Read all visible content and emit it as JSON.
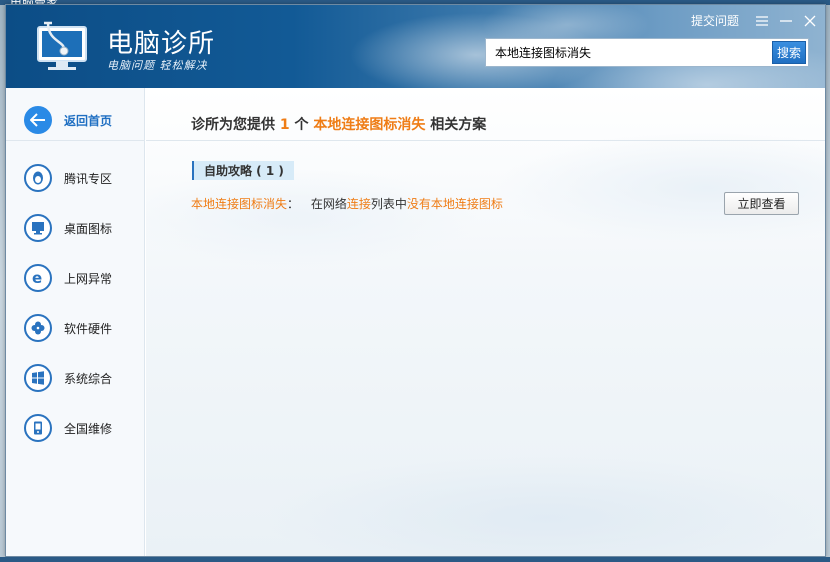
{
  "bg_title": "电脑管家",
  "header": {
    "brand_name": "电脑诊所",
    "slogan": "电脑问题  轻松解决",
    "feedback_label": "提交问题"
  },
  "search": {
    "value": "本地连接图标消失",
    "button_label": "搜索"
  },
  "sidebar": {
    "items": [
      {
        "label": "返回首页",
        "icon": "back-arrow-icon"
      },
      {
        "label": "腾讯专区",
        "icon": "qq-penguin-icon"
      },
      {
        "label": "桌面图标",
        "icon": "monitor-icon"
      },
      {
        "label": "上网异常",
        "icon": "ie-icon"
      },
      {
        "label": "软件硬件",
        "icon": "clover-icon"
      },
      {
        "label": "系统综合",
        "icon": "windows-logo-icon"
      },
      {
        "label": "全国维修",
        "icon": "phone-icon"
      }
    ]
  },
  "main": {
    "summary_prefix": "诊所为您提供",
    "summary_count": "1",
    "summary_unit": "个",
    "summary_keyword": "本地连接图标消失",
    "summary_suffix": "相关方案",
    "section_label": "自助攻略 ( 1 )",
    "result": {
      "title": "本地连接图标消失",
      "sep": "：",
      "desc_1": "在网络",
      "desc_2": "连接",
      "desc_3": "列表中",
      "desc_4": "没有本地连接图标",
      "button_label": "立即查看"
    }
  },
  "colors": {
    "accent_blue": "#2a73bf",
    "highlight_orange": "#ef7d16"
  }
}
